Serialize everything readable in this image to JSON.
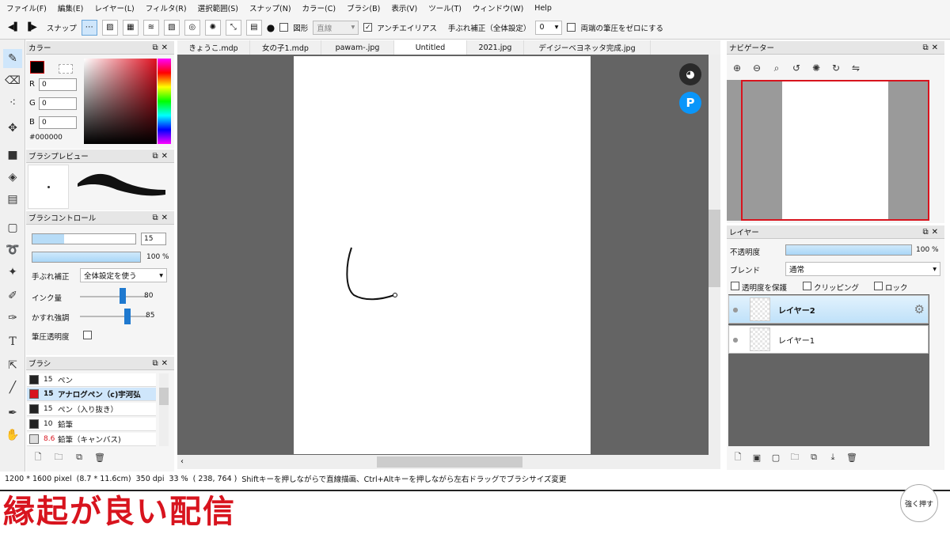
{
  "menu": [
    "ファイル(F)",
    "編集(E)",
    "レイヤー(L)",
    "フィルタ(R)",
    "選択範囲(S)",
    "スナップ(N)",
    "カラー(C)",
    "ブラシ(B)",
    "表示(V)",
    "ツール(T)",
    "ウィンドウ(W)",
    "Help"
  ],
  "toolbar": {
    "snap_label": "スナップ",
    "shape_label": "図形",
    "shape_value": "直線",
    "antialias_label": "アンチエイリアス",
    "stabilizer_label": "手ぶれ補正（全体設定）",
    "stabilizer_value": "0",
    "pressure_zero_label": "両端の筆圧をゼロにする"
  },
  "color_panel": {
    "title": "カラー",
    "r_label": "R",
    "r_value": "0",
    "g_label": "G",
    "g_value": "0",
    "b_label": "B",
    "b_value": "0",
    "hex": "#000000",
    "current_color": "#000000"
  },
  "brush_preview": {
    "title": "ブラシプレビュー"
  },
  "brush_control": {
    "title": "ブラシコントロール",
    "size_value": "15",
    "opacity_value": "100 %",
    "stabilizer_label": "手ぶれ補正",
    "stabilizer_value": "全体設定を使う",
    "ink_label": "インク量",
    "ink_value": "80",
    "ink_level": 0.8,
    "blur_label": "かすれ強調",
    "blur_value": "85",
    "blur_level": 0.85,
    "pressure_opacity_label": "筆圧透明度"
  },
  "brush_list": {
    "title": "ブラシ",
    "items": [
      {
        "size": "15",
        "name": "ペン",
        "swatch": "#222222"
      },
      {
        "size": "15",
        "name": "アナログペン（c)宇河弘",
        "swatch": "#d8141e"
      },
      {
        "size": "15",
        "name": "ペン（入り抜き）",
        "swatch": "#222222"
      },
      {
        "size": "10",
        "name": "鉛筆",
        "swatch": "#222222"
      },
      {
        "size": "8.6",
        "name": "鉛筆（キャンバス)",
        "swatch": "#dddddd"
      }
    ]
  },
  "tabs": [
    "きょうこ.mdp",
    "女の子1.mdp",
    "pawam-.jpg",
    "Untitled",
    "2021.jpg",
    "デイジーベヨネッタ完成.jpg"
  ],
  "navigator": {
    "title": "ナビゲーター"
  },
  "layers": {
    "title": "レイヤー",
    "opacity_label": "不透明度",
    "opacity_value": "100 %",
    "blend_label": "ブレンド",
    "blend_value": "通常",
    "protect_label": "透明度を保護",
    "clipping_label": "クリッピング",
    "lock_label": "ロック",
    "items": [
      {
        "name": "レイヤー2"
      },
      {
        "name": "レイヤー1"
      }
    ]
  },
  "status": {
    "size": "1200 * 1600 pixel",
    "physical": "(8.7 * 11.6cm)",
    "dpi": "350 dpi",
    "zoom": "33 %",
    "coords": "( 238, 764 )",
    "hint": "Shiftキーを押しながらで直線描画、Ctrl+Altキーを押しながら左右ドラッグでブラシサイズ変更"
  },
  "overlay": {
    "title": "縁起が良い配信",
    "push_label": "強く押す"
  }
}
